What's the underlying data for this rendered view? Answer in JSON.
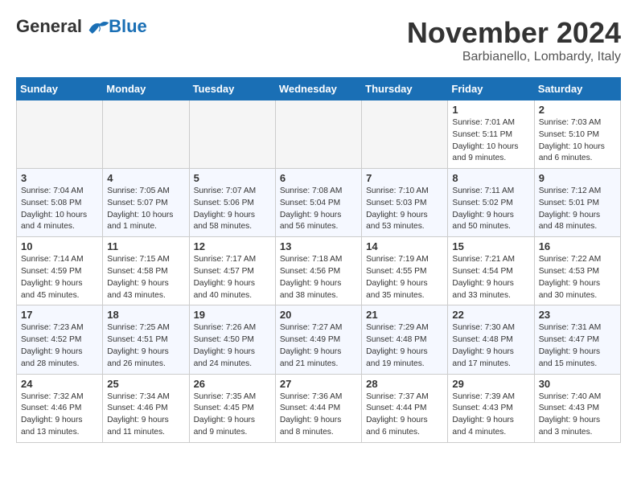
{
  "logo": {
    "line1": "General",
    "line2": "Blue"
  },
  "title": "November 2024",
  "location": "Barbianello, Lombardy, Italy",
  "weekdays": [
    "Sunday",
    "Monday",
    "Tuesday",
    "Wednesday",
    "Thursday",
    "Friday",
    "Saturday"
  ],
  "weeks": [
    [
      {
        "day": "",
        "detail": ""
      },
      {
        "day": "",
        "detail": ""
      },
      {
        "day": "",
        "detail": ""
      },
      {
        "day": "",
        "detail": ""
      },
      {
        "day": "",
        "detail": ""
      },
      {
        "day": "1",
        "detail": "Sunrise: 7:01 AM\nSunset: 5:11 PM\nDaylight: 10 hours\nand 9 minutes."
      },
      {
        "day": "2",
        "detail": "Sunrise: 7:03 AM\nSunset: 5:10 PM\nDaylight: 10 hours\nand 6 minutes."
      }
    ],
    [
      {
        "day": "3",
        "detail": "Sunrise: 7:04 AM\nSunset: 5:08 PM\nDaylight: 10 hours\nand 4 minutes."
      },
      {
        "day": "4",
        "detail": "Sunrise: 7:05 AM\nSunset: 5:07 PM\nDaylight: 10 hours\nand 1 minute."
      },
      {
        "day": "5",
        "detail": "Sunrise: 7:07 AM\nSunset: 5:06 PM\nDaylight: 9 hours\nand 58 minutes."
      },
      {
        "day": "6",
        "detail": "Sunrise: 7:08 AM\nSunset: 5:04 PM\nDaylight: 9 hours\nand 56 minutes."
      },
      {
        "day": "7",
        "detail": "Sunrise: 7:10 AM\nSunset: 5:03 PM\nDaylight: 9 hours\nand 53 minutes."
      },
      {
        "day": "8",
        "detail": "Sunrise: 7:11 AM\nSunset: 5:02 PM\nDaylight: 9 hours\nand 50 minutes."
      },
      {
        "day": "9",
        "detail": "Sunrise: 7:12 AM\nSunset: 5:01 PM\nDaylight: 9 hours\nand 48 minutes."
      }
    ],
    [
      {
        "day": "10",
        "detail": "Sunrise: 7:14 AM\nSunset: 4:59 PM\nDaylight: 9 hours\nand 45 minutes."
      },
      {
        "day": "11",
        "detail": "Sunrise: 7:15 AM\nSunset: 4:58 PM\nDaylight: 9 hours\nand 43 minutes."
      },
      {
        "day": "12",
        "detail": "Sunrise: 7:17 AM\nSunset: 4:57 PM\nDaylight: 9 hours\nand 40 minutes."
      },
      {
        "day": "13",
        "detail": "Sunrise: 7:18 AM\nSunset: 4:56 PM\nDaylight: 9 hours\nand 38 minutes."
      },
      {
        "day": "14",
        "detail": "Sunrise: 7:19 AM\nSunset: 4:55 PM\nDaylight: 9 hours\nand 35 minutes."
      },
      {
        "day": "15",
        "detail": "Sunrise: 7:21 AM\nSunset: 4:54 PM\nDaylight: 9 hours\nand 33 minutes."
      },
      {
        "day": "16",
        "detail": "Sunrise: 7:22 AM\nSunset: 4:53 PM\nDaylight: 9 hours\nand 30 minutes."
      }
    ],
    [
      {
        "day": "17",
        "detail": "Sunrise: 7:23 AM\nSunset: 4:52 PM\nDaylight: 9 hours\nand 28 minutes."
      },
      {
        "day": "18",
        "detail": "Sunrise: 7:25 AM\nSunset: 4:51 PM\nDaylight: 9 hours\nand 26 minutes."
      },
      {
        "day": "19",
        "detail": "Sunrise: 7:26 AM\nSunset: 4:50 PM\nDaylight: 9 hours\nand 24 minutes."
      },
      {
        "day": "20",
        "detail": "Sunrise: 7:27 AM\nSunset: 4:49 PM\nDaylight: 9 hours\nand 21 minutes."
      },
      {
        "day": "21",
        "detail": "Sunrise: 7:29 AM\nSunset: 4:48 PM\nDaylight: 9 hours\nand 19 minutes."
      },
      {
        "day": "22",
        "detail": "Sunrise: 7:30 AM\nSunset: 4:48 PM\nDaylight: 9 hours\nand 17 minutes."
      },
      {
        "day": "23",
        "detail": "Sunrise: 7:31 AM\nSunset: 4:47 PM\nDaylight: 9 hours\nand 15 minutes."
      }
    ],
    [
      {
        "day": "24",
        "detail": "Sunrise: 7:32 AM\nSunset: 4:46 PM\nDaylight: 9 hours\nand 13 minutes."
      },
      {
        "day": "25",
        "detail": "Sunrise: 7:34 AM\nSunset: 4:46 PM\nDaylight: 9 hours\nand 11 minutes."
      },
      {
        "day": "26",
        "detail": "Sunrise: 7:35 AM\nSunset: 4:45 PM\nDaylight: 9 hours\nand 9 minutes."
      },
      {
        "day": "27",
        "detail": "Sunrise: 7:36 AM\nSunset: 4:44 PM\nDaylight: 9 hours\nand 8 minutes."
      },
      {
        "day": "28",
        "detail": "Sunrise: 7:37 AM\nSunset: 4:44 PM\nDaylight: 9 hours\nand 6 minutes."
      },
      {
        "day": "29",
        "detail": "Sunrise: 7:39 AM\nSunset: 4:43 PM\nDaylight: 9 hours\nand 4 minutes."
      },
      {
        "day": "30",
        "detail": "Sunrise: 7:40 AM\nSunset: 4:43 PM\nDaylight: 9 hours\nand 3 minutes."
      }
    ]
  ]
}
